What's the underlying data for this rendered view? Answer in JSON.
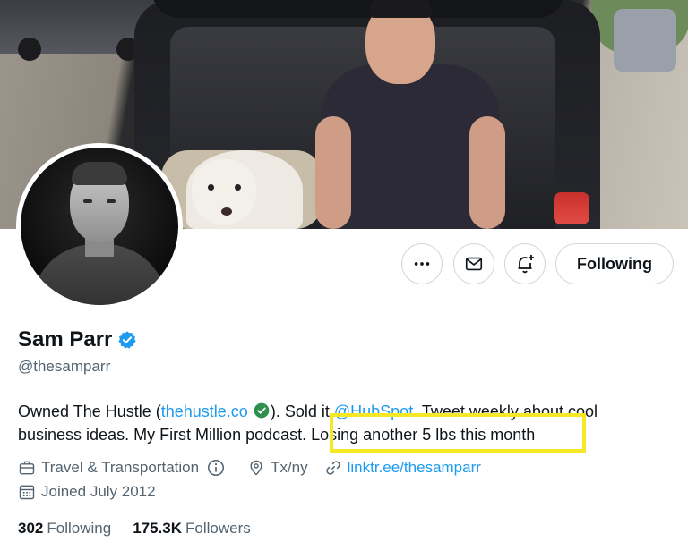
{
  "profile": {
    "name": "Sam Parr",
    "handle": "@thesamparr",
    "verified": true
  },
  "actions": {
    "more_icon": "more-horizontal-icon",
    "message_icon": "envelope-icon",
    "notify_icon": "bell-plus-icon",
    "following_label": "Following"
  },
  "bio": {
    "part1": "Owned The Hustle (",
    "link": "thehustle.co",
    "part2": "). Sold it ",
    "mention": "@HubSpot",
    "part3": ". Tweet weekly about cool business ideas. My First Million podcast. ",
    "highlighted": "Losing another 5 lbs this month"
  },
  "meta": {
    "category": "Travel & Transportation",
    "location": "Tx/ny",
    "website": "linktr.ee/thesamparr",
    "joined": "Joined July 2012"
  },
  "counts": {
    "following_num": "302",
    "following_label": "Following",
    "followers_num": "175.3K",
    "followers_label": "Followers"
  },
  "colors": {
    "accent": "#1d9bf0",
    "highlight": "#f6e825",
    "secondary_text": "#536471"
  }
}
